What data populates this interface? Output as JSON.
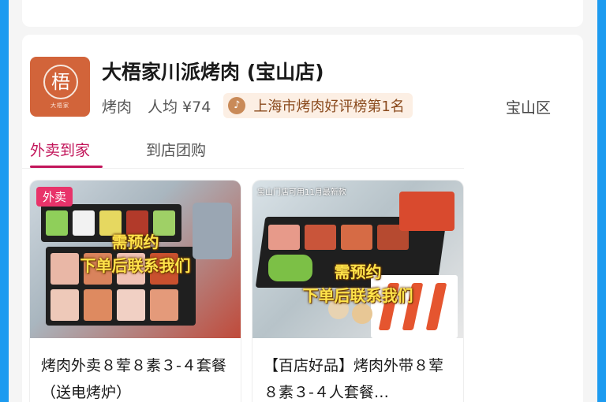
{
  "store": {
    "logo_char": "梧",
    "logo_subtext": "大梧家",
    "name": "大梧家川派烤肉 (宝山店)",
    "category": "烤肉",
    "avg_price": "人均 ¥74",
    "rank_badge": "上海市烤肉好评榜第1名",
    "district": "宝山区"
  },
  "tabs": [
    {
      "label": "外卖到家",
      "active": true
    },
    {
      "label": "到店团购",
      "active": false
    }
  ],
  "products": [
    {
      "tag": "外卖",
      "overlay_line1": "需预约",
      "overlay_line2": "下单后联系我们",
      "title": "烤肉外卖８荤８素３-４套餐（送电烤炉）"
    },
    {
      "caption": "宝山门店可用11月最新款",
      "overlay_line1": "需预约",
      "overlay_line2": "下单后联系我们",
      "title": "【百店好品】烤肉外带８荤８素３-４人套餐…"
    }
  ],
  "colors": {
    "accent": "#c2155a",
    "logo_bg": "#d2643a",
    "badge_bg": "#fcefe4",
    "frame": "#1d9bf0"
  }
}
